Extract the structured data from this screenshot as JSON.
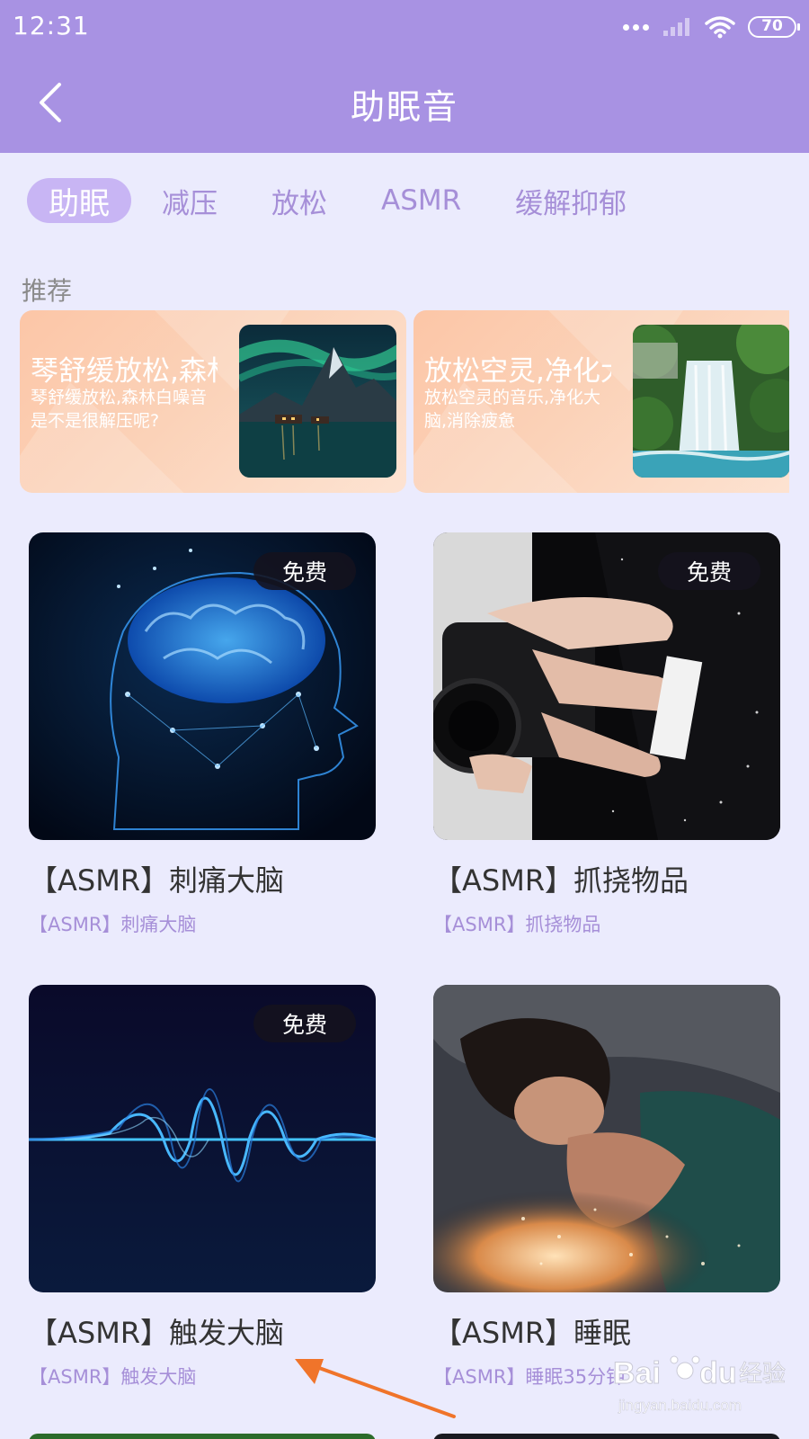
{
  "status_bar": {
    "time": "12:31",
    "battery": "70"
  },
  "header": {
    "title": "助眠音"
  },
  "tabs": [
    {
      "label": "助眠",
      "active": true
    },
    {
      "label": "减压",
      "active": false
    },
    {
      "label": "放松",
      "active": false
    },
    {
      "label": "ASMR",
      "active": false
    },
    {
      "label": "缓解抑郁",
      "active": false
    }
  ],
  "recommend": {
    "section_title": "推荐",
    "cards": [
      {
        "title": "琴舒缓放松,森林",
        "desc": "琴舒缓放松,森林白噪音是不是很解压呢?",
        "image": "aurora-mountain-lake"
      },
      {
        "title": "放松空灵,净化大",
        "desc": "放松空灵的音乐,净化大脑,消除疲惫",
        "image": "waterfall-forest"
      }
    ]
  },
  "cards": [
    {
      "title": "【ASMR】刺痛大脑",
      "subtitle": "【ASMR】刺痛大脑",
      "badge": "免费",
      "image": "glowing-brain-head"
    },
    {
      "title": "【ASMR】抓挠物品",
      "subtitle": "【ASMR】抓挠物品",
      "badge": "免费",
      "image": "hands-holding-camera"
    },
    {
      "title": "【ASMR】触发大脑",
      "subtitle": "【ASMR】触发大脑",
      "badge": "免费",
      "image": "blue-sound-wave"
    },
    {
      "title": "【ASMR】睡眠",
      "subtitle": "【ASMR】睡眠35分钟",
      "badge": null,
      "image": "sleeping-woman-glow"
    }
  ],
  "colors": {
    "header": "#a892e3",
    "background": "#ebebfd",
    "accent": "#a68fd8",
    "annotation_arrow": "#f0742a"
  },
  "watermark": {
    "brand": "Baidu",
    "brand_cn": "经验",
    "url": "jingyan.baidu.com"
  }
}
